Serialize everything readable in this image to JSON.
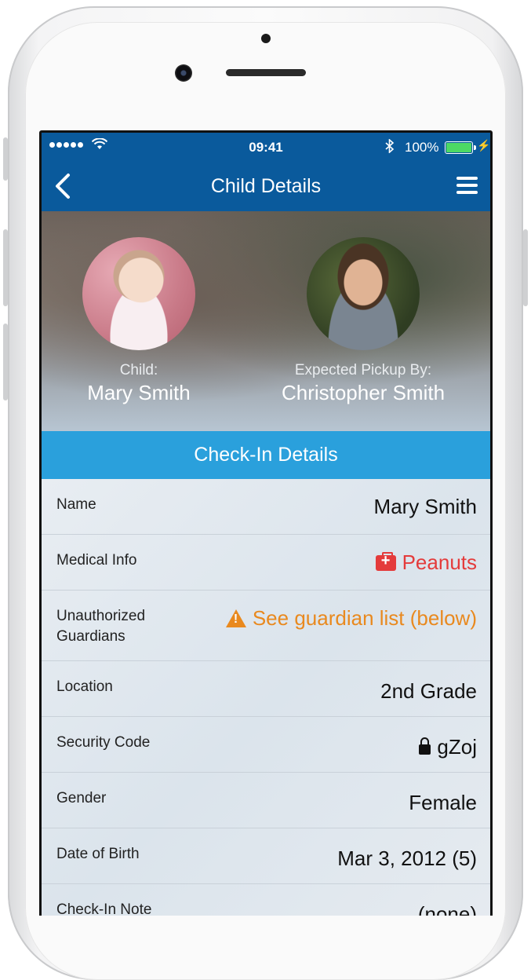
{
  "status_bar": {
    "time": "09:41",
    "battery": "100%",
    "signal_dots": 5
  },
  "nav": {
    "title": "Child Details",
    "back_icon": "chevron-left-icon",
    "menu_icon": "hamburger-icon"
  },
  "profile": {
    "child_label": "Child:",
    "child_name": "Mary Smith",
    "pickup_label": "Expected Pickup By:",
    "pickup_name": "Christopher Smith"
  },
  "section": {
    "title": "Check-In Details"
  },
  "details": [
    {
      "key": "Name",
      "value": "Mary Smith"
    },
    {
      "key": "Medical Info",
      "value": "Peanuts",
      "icon": "medkit-icon",
      "color": "#e43b3b"
    },
    {
      "key": "Unauthorized Guardians",
      "value": "See guardian list (below)",
      "icon": "warning-icon",
      "color": "#e9891e"
    },
    {
      "key": "Location",
      "value": "2nd Grade"
    },
    {
      "key": "Security Code",
      "value": "gZoj",
      "icon": "lock-icon"
    },
    {
      "key": "Gender",
      "value": "Female"
    },
    {
      "key": "Date of Birth",
      "value": "Mar 3, 2012 (5)"
    },
    {
      "key": "Check-In Note",
      "value": "(none)"
    }
  ],
  "colors": {
    "nav": "#0a5a9c",
    "section": "#2aa0dc"
  }
}
